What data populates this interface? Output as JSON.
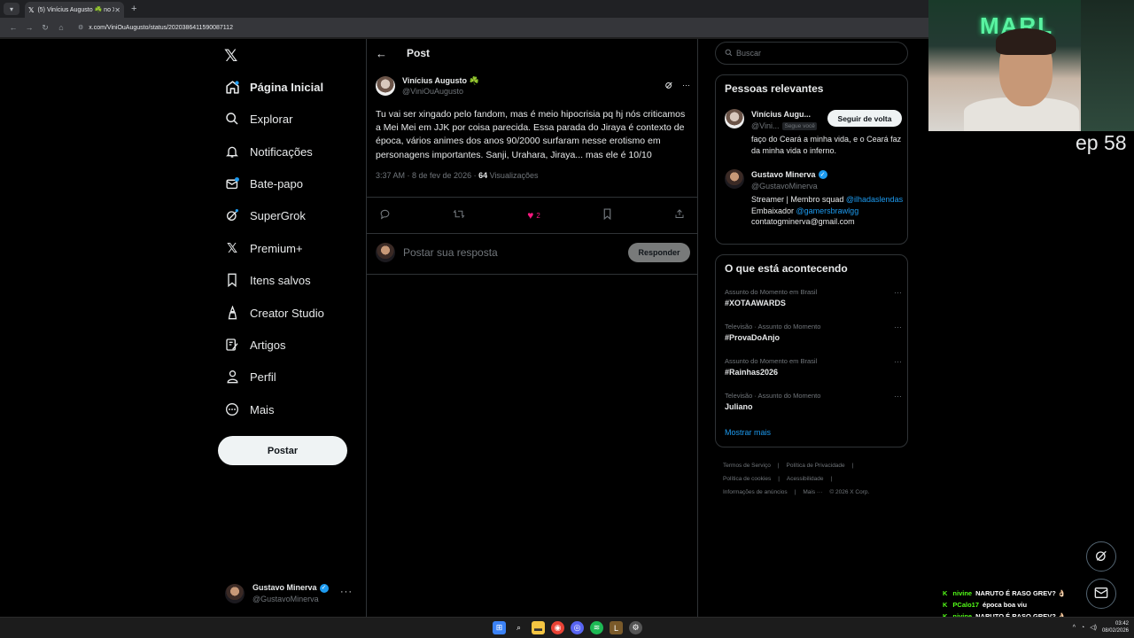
{
  "browser": {
    "tab_title": "(5) Vinícius Augusto ☘️ no X: \"...",
    "url": "x.com/ViniOuAugusto/status/2020386411590087112"
  },
  "nav": {
    "items": [
      {
        "label": "Página Inicial",
        "icon": "home-icon"
      },
      {
        "label": "Explorar",
        "icon": "search-icon"
      },
      {
        "label": "Notificações",
        "icon": "bell-icon"
      },
      {
        "label": "Bate-papo",
        "icon": "mail-icon"
      },
      {
        "label": "SuperGrok",
        "icon": "grok-icon"
      },
      {
        "label": "Premium+",
        "icon": "x-icon"
      },
      {
        "label": "Itens salvos",
        "icon": "bookmark-icon"
      },
      {
        "label": "Creator Studio",
        "icon": "creator-icon"
      },
      {
        "label": "Artigos",
        "icon": "article-icon"
      },
      {
        "label": "Perfil",
        "icon": "person-icon"
      },
      {
        "label": "Mais",
        "icon": "more-circle-icon"
      }
    ],
    "post_button": "Postar",
    "account": {
      "name": "Gustavo Minerva",
      "handle": "@GustavoMinerva",
      "more": "···"
    }
  },
  "main": {
    "header_title": "Post",
    "tweet": {
      "author_name": "Vinícius Augusto",
      "author_emoji": "☘️",
      "author_handle": "@ViniOuAugusto",
      "text": "Tu vai ser xingado pelo fandom, mas é meio hipocrisia pq hj nós criticamos a Mei Mei em JJK por coisa parecida. Essa parada do Jiraya é contexto de época, vários animes dos anos 90/2000 surfaram nesse erotismo em personagens importantes. Sanji, Urahara, Jiraya... mas ele é 10/10",
      "time": "3:37 AM · 8 de fev de 2026 · ",
      "views_count": "64",
      "views_label": " Visualizações",
      "likes": "2"
    },
    "reply": {
      "placeholder": "Postar sua resposta",
      "button": "Responder"
    }
  },
  "right": {
    "search_placeholder": "Buscar",
    "relevant_title": "Pessoas relevantes",
    "people": [
      {
        "name": "Vinícius Augu...",
        "handle": "@Vini...",
        "badge": "Segue você",
        "follow": "Seguir de volta",
        "bio": "faço do Ceará a minha vida, e o Ceará faz da minha vida o inferno."
      },
      {
        "name": "Gustavo Minerva",
        "handle": "@GustavoMinerva",
        "bio_1": "Streamer | Membro squad ",
        "bio_link1": "@ilhadaslendas",
        "bio_2": " Embaixador ",
        "bio_link2": "@gamersbrawlgg",
        "bio_3": "contatogminerva@gmail.com"
      }
    ],
    "happening_title": "O que está acontecendo",
    "trends": [
      {
        "category": "Assunto do Momento em Brasil",
        "title": "#XOTAAWARDS"
      },
      {
        "category": "Televisão · Assunto do Momento",
        "title": "#ProvaDoAnjo"
      },
      {
        "category": "Assunto do Momento em Brasil",
        "title": "#Rainhas2026"
      },
      {
        "category": "Televisão · Assunto do Momento",
        "title": "Juliano"
      }
    ],
    "show_more": "Mostrar mais",
    "footer": [
      "Termos de Serviço",
      "|",
      "Política de Privacidade",
      "|",
      "Política de cookies",
      "|",
      "Acessibilidade",
      "|",
      "Informações de anúncios",
      "|",
      "Mais ···",
      "© 2026 X Corp."
    ]
  },
  "stream": {
    "episode": "ep 58",
    "neon_text": "MARL",
    "chat": [
      {
        "user": "nivine",
        "msg": "NARUTO É RASO GREV? 👌🏻"
      },
      {
        "user": "PCalo17",
        "msg": "época boa viu"
      },
      {
        "user": "nivine",
        "msg": "NARUTO É RASO GREV? 👌🏻"
      }
    ]
  },
  "taskbar": {
    "time": "03:42",
    "date": "08/02/2026"
  }
}
